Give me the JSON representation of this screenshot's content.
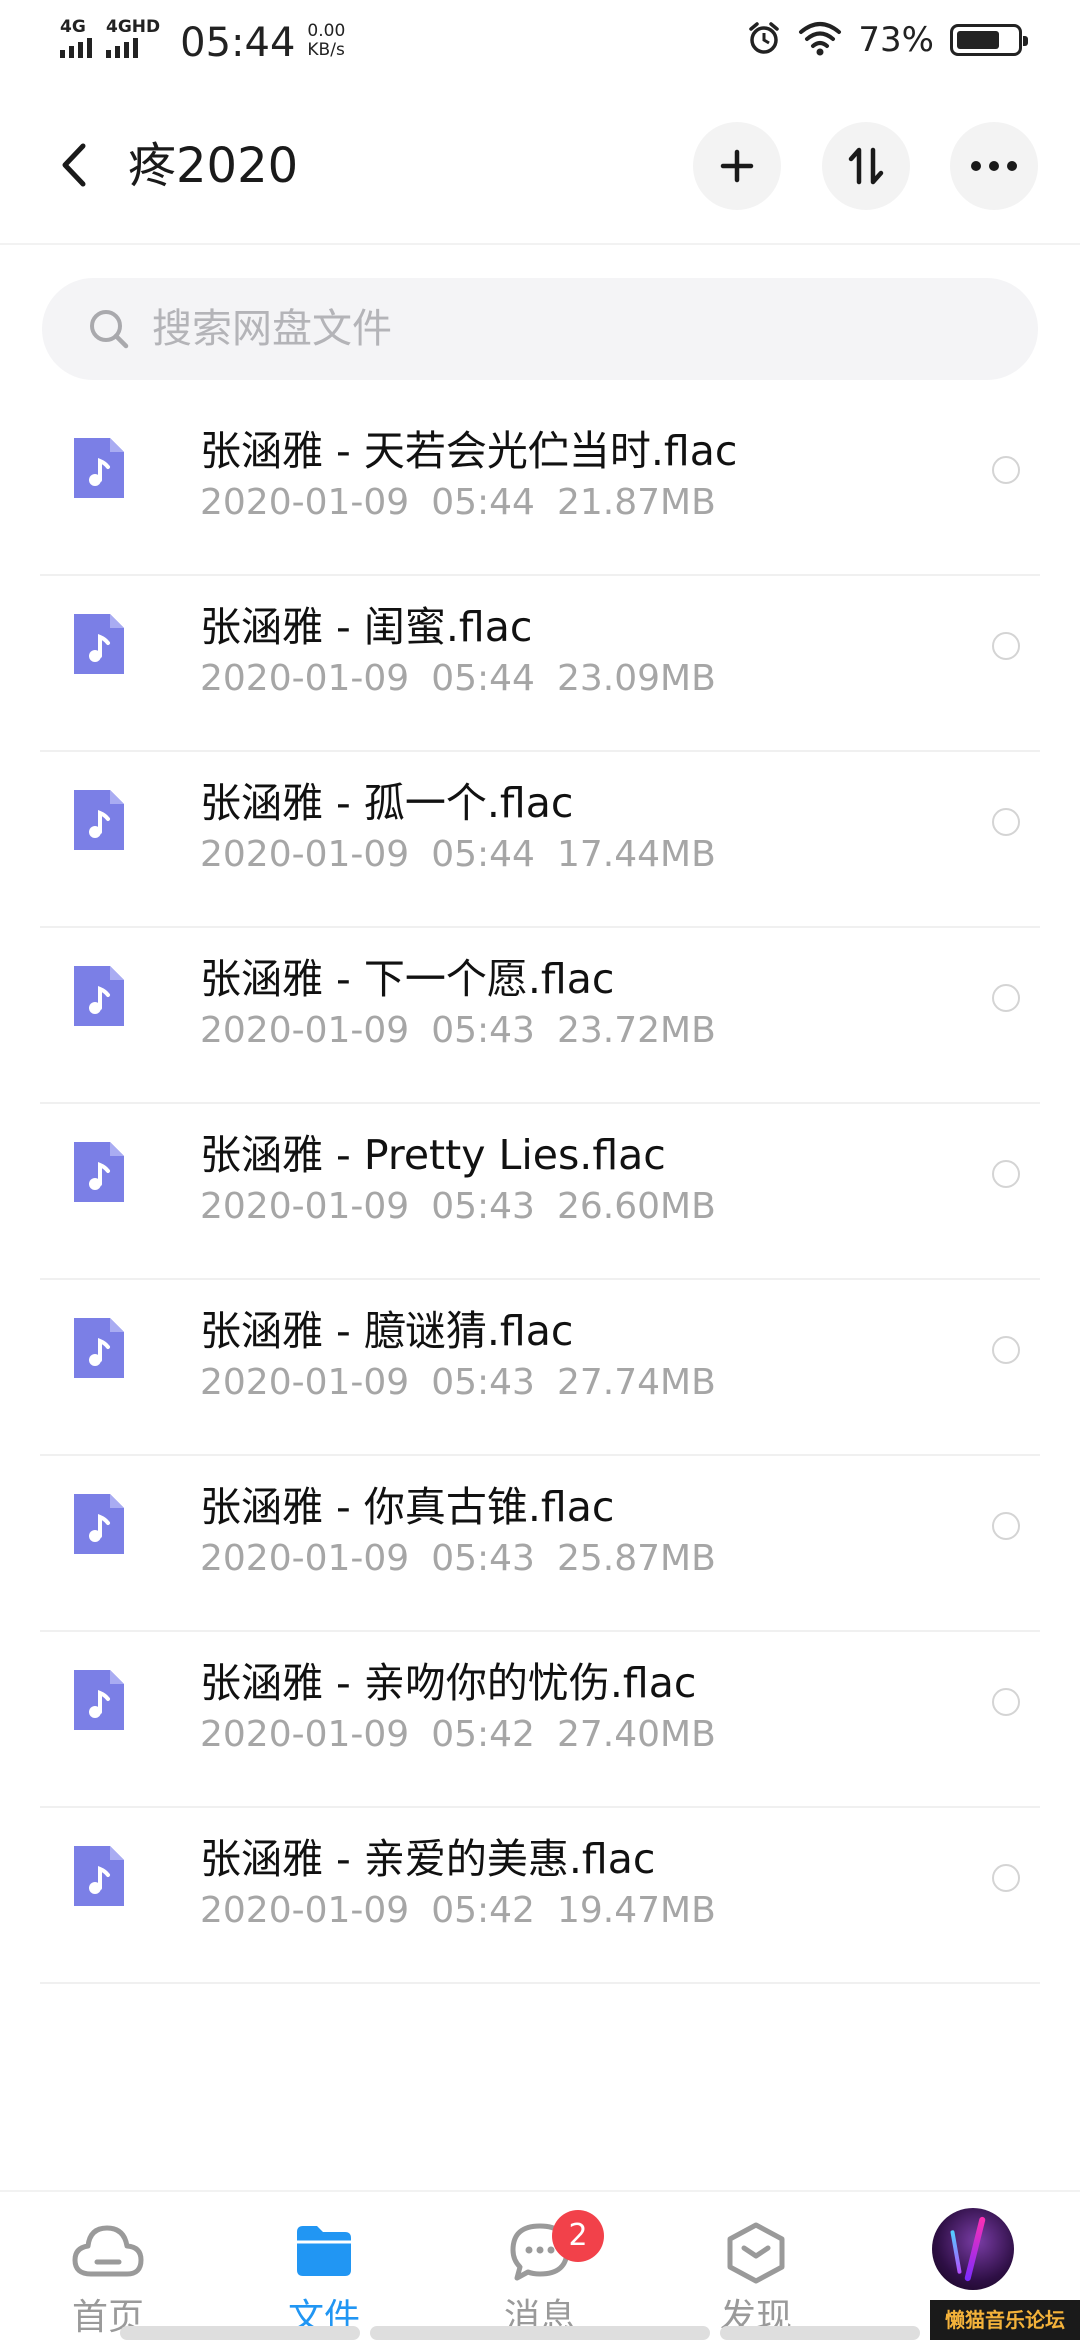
{
  "status_bar": {
    "signal_1": "4G",
    "signal_2": "4GHD",
    "time": "05:44",
    "speed_value": "0.00",
    "speed_unit": "KB/s",
    "battery_percent": "73%",
    "battery_level": 0.73,
    "icons": [
      "alarm-icon",
      "wifi-icon",
      "battery-icon"
    ]
  },
  "header": {
    "title": "疼2020",
    "back_icon": "chevron-left-icon",
    "actions": [
      "plus-icon",
      "sort-icon",
      "more-icon"
    ]
  },
  "search": {
    "placeholder": "搜索网盘文件"
  },
  "files": [
    {
      "name": "张涵雅 - 天若会光伫当时.flac",
      "date": "2020-01-09",
      "time": "05:44",
      "size": "21.87MB"
    },
    {
      "name": "张涵雅 - 闺蜜.flac",
      "date": "2020-01-09",
      "time": "05:44",
      "size": "23.09MB"
    },
    {
      "name": "张涵雅 - 孤一个.flac",
      "date": "2020-01-09",
      "time": "05:44",
      "size": "17.44MB"
    },
    {
      "name": "张涵雅 - 下一个愿.flac",
      "date": "2020-01-09",
      "time": "05:43",
      "size": "23.72MB"
    },
    {
      "name": "张涵雅 - Pretty Lies.flac",
      "date": "2020-01-09",
      "time": "05:43",
      "size": "26.60MB"
    },
    {
      "name": "张涵雅 - 臆谜猜.flac",
      "date": "2020-01-09",
      "time": "05:43",
      "size": "27.74MB"
    },
    {
      "name": "张涵雅 - 你真古锥.flac",
      "date": "2020-01-09",
      "time": "05:43",
      "size": "25.87MB"
    },
    {
      "name": "张涵雅 - 亲吻你的忧伤.flac",
      "date": "2020-01-09",
      "time": "05:42",
      "size": "27.40MB"
    },
    {
      "name": "张涵雅 - 亲爱的美惠.flac",
      "date": "2020-01-09",
      "time": "05:42",
      "size": "19.47MB"
    }
  ],
  "bottom_nav": {
    "home": "首页",
    "files": "文件",
    "messages": "消息",
    "messages_badge": "2",
    "discover": "发现",
    "active": "files"
  },
  "watermark": "懒猫音乐论坛",
  "colors": {
    "accent": "#2196f3",
    "file_icon": "#7b7fe6",
    "badge": "#f2414a"
  }
}
